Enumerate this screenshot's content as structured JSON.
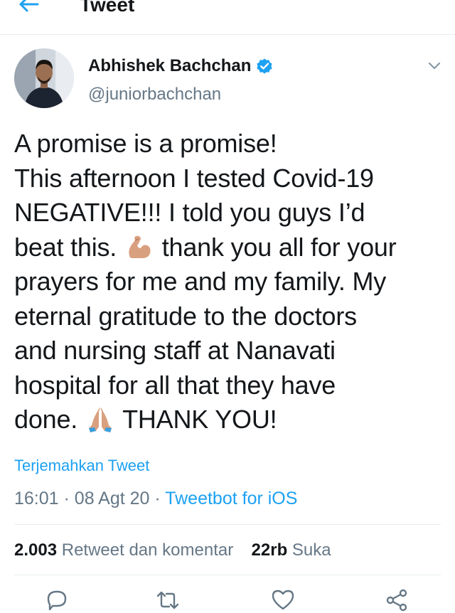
{
  "header": {
    "title": "Tweet",
    "back_icon": "arrow-left-icon"
  },
  "author": {
    "display_name": "Abhishek Bachchan",
    "handle": "@juniorbachchan",
    "verified": true
  },
  "tweet": {
    "lines": [
      "A promise is a promise!",
      "This afternoon I tested Covid-19",
      "NEGATIVE!!! I told you guys I’d",
      "beat this.",
      "thank you all for your",
      "prayers for me and my family. My",
      "eternal gratitude to the doctors",
      "and nursing staff at Nanavati",
      "hospital for all that they have",
      "done.",
      "THANK YOU!"
    ],
    "emoji_1": "flexed-biceps-emoji",
    "emoji_2": "folded-hands-emoji"
  },
  "translate_label": "Terjemahkan Tweet",
  "meta": {
    "time": "16:01",
    "date": "08 Agt 20",
    "source": "Tweetbot for iOS",
    "sep": "·"
  },
  "stats": {
    "retweets_count": "2.003",
    "retweets_label": "Retweet dan komentar",
    "likes_count": "22rb",
    "likes_label": "Suka"
  },
  "colors": {
    "accent": "#1da1f2",
    "muted": "#657786",
    "text": "#14171a",
    "border": "#e6ecf0"
  }
}
